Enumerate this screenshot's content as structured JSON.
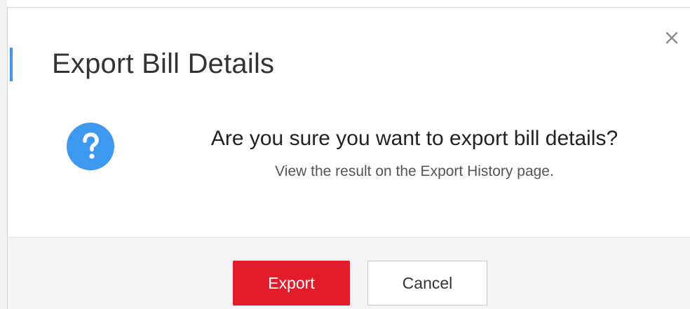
{
  "dialog": {
    "title": "Export Bill Details",
    "close_icon": "close-icon",
    "question_icon": "question-circle-icon",
    "message": "Are you sure you want to export bill details?",
    "submessage": "View the result on the Export History page.",
    "export_label": "Export",
    "cancel_label": "Cancel"
  },
  "colors": {
    "accent": "#3d99ef",
    "primary_button": "#e11d2b",
    "question_icon": "#3d99ef"
  }
}
